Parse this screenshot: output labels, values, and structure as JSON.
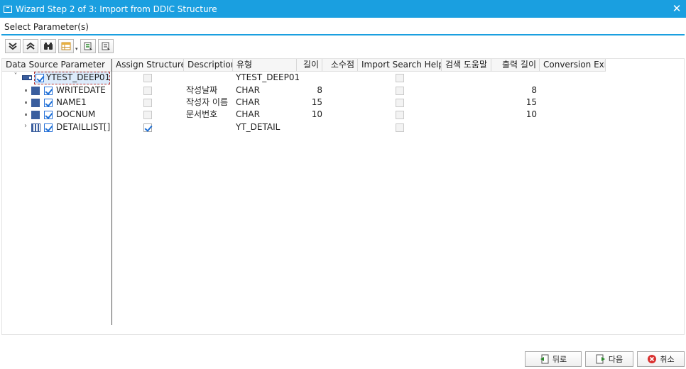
{
  "window": {
    "title": "Wizard Step 2 of 3: Import from DDIC Structure",
    "close_glyph": "✕"
  },
  "section": {
    "label": "Select Parameter(s)"
  },
  "toolbar": {
    "icons": [
      "expand-all-icon",
      "collapse-all-icon",
      "find-icon",
      "layout-icon",
      "select-all-icon",
      "deselect-all-icon"
    ]
  },
  "table": {
    "headers": {
      "param": "Data Source Parameter",
      "assign": "Assign Structure",
      "desc": "Description",
      "type": "유형",
      "len": "길이",
      "dec": "소수점",
      "ish": "Import Search Help",
      "sh": "검색 도움말",
      "outlen": "출력 길이",
      "conv": "Conversion Exit"
    },
    "rows": [
      {
        "name": "YTEST_DEEP01",
        "assign": false,
        "desc": "",
        "type": "YTEST_DEEP01",
        "len": "",
        "dec": "",
        "ish": false,
        "sh": "",
        "outlen": "",
        "conv": ""
      },
      {
        "name": "WRITEDATE",
        "assign": false,
        "desc": "작성날짜",
        "type": "CHAR",
        "len": "8",
        "dec": "",
        "ish": false,
        "sh": "",
        "outlen": "8",
        "conv": ""
      },
      {
        "name": "NAME1",
        "assign": false,
        "desc": "작성자 이름",
        "type": "CHAR",
        "len": "15",
        "dec": "",
        "ish": false,
        "sh": "",
        "outlen": "15",
        "conv": ""
      },
      {
        "name": "DOCNUM",
        "assign": false,
        "desc": "문서번호",
        "type": "CHAR",
        "len": "10",
        "dec": "",
        "ish": false,
        "sh": "",
        "outlen": "10",
        "conv": ""
      },
      {
        "name": "DETAILLIST[]",
        "assign": true,
        "desc": "",
        "type": "YT_DETAIL",
        "len": "",
        "dec": "",
        "ish": false,
        "sh": "",
        "outlen": "",
        "conv": ""
      }
    ]
  },
  "buttons": {
    "back": "뒤로",
    "next": "다음",
    "cancel": "취소"
  },
  "colors": {
    "titlebar": "#1A9FE0",
    "accent": "#1d6fd6",
    "cancel_icon": "#d9302f"
  }
}
